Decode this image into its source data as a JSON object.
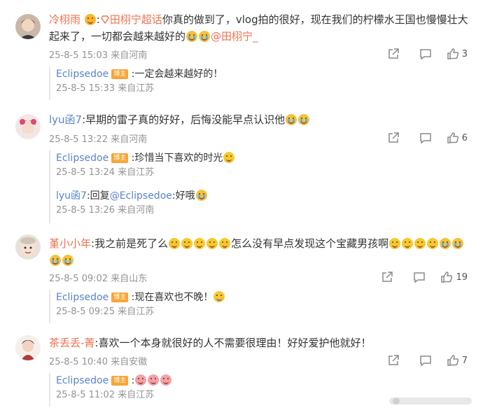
{
  "comments": [
    {
      "user": "冷栩雨",
      "topic": "田栩宁超话",
      "text": "你真的做到了，vlog拍的很好，现在我们的柠檬水王国也慢慢壮大起来了，一切都会越来越好的",
      "mention": "@田栩宁_",
      "time": "25-8-5 15:03",
      "location": "来自河南",
      "likes": "3",
      "reply": {
        "user": "Eclipsedoe",
        "badge": "博主",
        "text": ":一定会越来越好的！",
        "time": "25-8-5 15:33",
        "location": "来自江苏"
      }
    },
    {
      "user": "lyu函7",
      "text": ":早期的雷子真的好好，后悔没能早点认识他",
      "time": "25-8-5 13:22",
      "location": "来自河南",
      "likes": "6",
      "reply1": {
        "user": "Eclipsedoe",
        "badge": "博主",
        "text": ":珍惜当下喜欢的时光",
        "time": "25-8-5 13:24",
        "location": "来自江苏"
      },
      "reply2": {
        "user": "lyu函7",
        "prefix": ":回复",
        "mention": "@Eclipsedoe",
        "text": ":好哦",
        "time": "25-8-5 13:26",
        "location": "来自河南"
      }
    },
    {
      "user": "堇小小年",
      "text1": ":我之前是死了么",
      "text2": "怎么没有早点发现这个宝藏男孩啊",
      "time": "25-8-5 09:02",
      "location": "来自山东",
      "likes": "19",
      "reply": {
        "user": "Eclipsedoe",
        "badge": "博主",
        "text": ":现在喜欢也不晚！",
        "time": "25-8-5 09:25",
        "location": "来自江苏"
      }
    },
    {
      "user": "茶丢丢-菁",
      "text": ":喜欢一个本身就很好的人不需要很理由！好好爱护他就好！",
      "time": "25-8-5 10:40",
      "location": "来自安徽",
      "likes": "7",
      "reply": {
        "user": "Eclipsedoe",
        "badge": "博主",
        "text": ":",
        "time": "25-8-5 11:02",
        "location": "来自江苏"
      }
    }
  ],
  "icons": [
    "share-icon",
    "comment-icon",
    "like-icon",
    "user-avatar"
  ],
  "colors": {
    "username": "#eb7350",
    "meta": "#939393",
    "badge": "#f7a635",
    "link": "#5a83c8"
  }
}
